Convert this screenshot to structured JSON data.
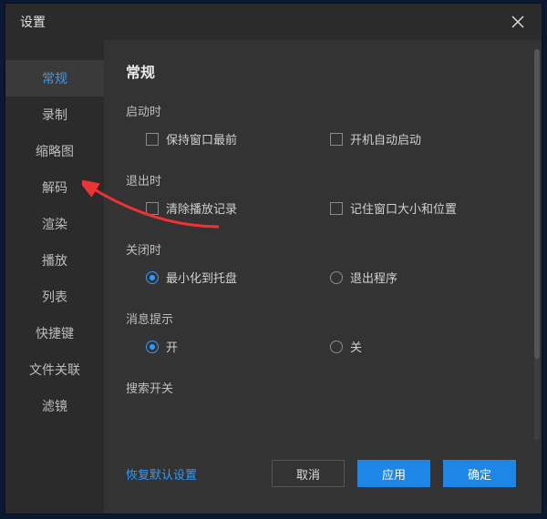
{
  "title": "设置",
  "sidebar": {
    "items": [
      {
        "label": "常规",
        "active": true
      },
      {
        "label": "录制",
        "active": false
      },
      {
        "label": "缩略图",
        "active": false
      },
      {
        "label": "解码",
        "active": false
      },
      {
        "label": "渲染",
        "active": false
      },
      {
        "label": "播放",
        "active": false
      },
      {
        "label": "列表",
        "active": false
      },
      {
        "label": "快捷键",
        "active": false
      },
      {
        "label": "文件关联",
        "active": false
      },
      {
        "label": "滤镜",
        "active": false
      }
    ]
  },
  "main": {
    "heading": "常规",
    "groups": {
      "startup": {
        "title": "启动时",
        "opt1": "保持窗口最前",
        "opt2": "开机自动启动"
      },
      "exit": {
        "title": "退出时",
        "opt1": "清除播放记录",
        "opt2": "记住窗口大小和位置"
      },
      "close": {
        "title": "关闭时",
        "opt1": "最小化到托盘",
        "opt2": "退出程序"
      },
      "msg": {
        "title": "消息提示",
        "opt1": "开",
        "opt2": "关"
      },
      "search": {
        "title": "搜索开关"
      }
    }
  },
  "footer": {
    "reset": "恢复默认设置",
    "cancel": "取消",
    "apply": "应用",
    "ok": "确定"
  }
}
